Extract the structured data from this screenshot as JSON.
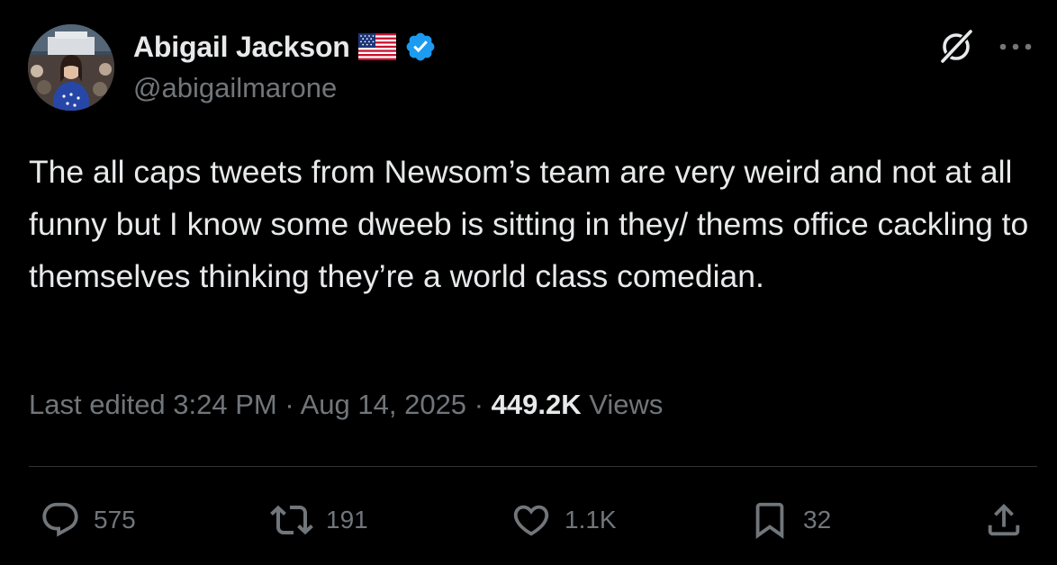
{
  "author": {
    "name": "Abigail Jackson",
    "handle": "@abigailmarone",
    "flag_icon": "us-flag-icon",
    "verified_icon": "verified-badge-icon",
    "verified_color": "#1d9bf0"
  },
  "tweet": {
    "text": "The all caps tweets from Newsom’s team are very weird and not at all funny but I know some dweeb is sitting in they/ thems office cackling to themselves thinking they’re a world class comedian."
  },
  "meta": {
    "edited_prefix": "Last edited",
    "time": "3:24 PM",
    "separator": "·",
    "date": "Aug 14, 2025",
    "views_count": "449.2K",
    "views_label": "Views"
  },
  "actions": {
    "replies": "575",
    "reposts": "191",
    "likes": "1.1K",
    "bookmarks": "32"
  },
  "colors": {
    "background": "#000000",
    "text_primary": "#e7e9ea",
    "text_secondary": "#71767b",
    "divider": "#2f3336"
  }
}
